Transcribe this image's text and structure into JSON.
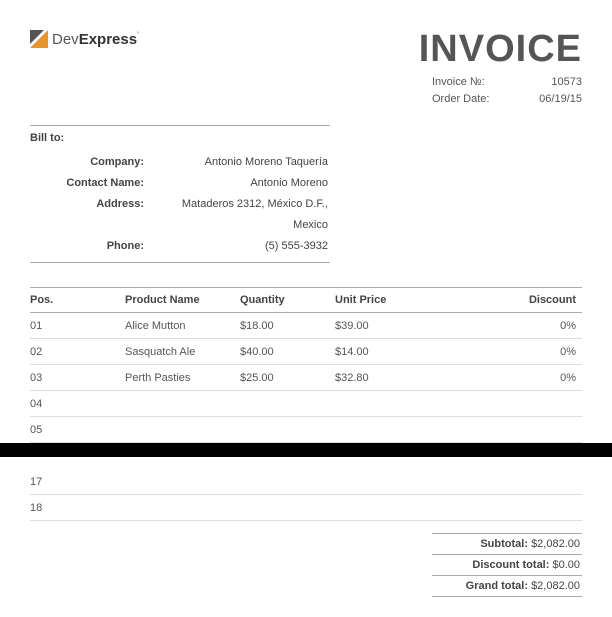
{
  "logo": {
    "dev": "Dev",
    "express": "Express",
    "tm": "'"
  },
  "title": "INVOICE",
  "meta": {
    "invoiceNumLabel": "Invoice №:",
    "invoiceNum": "10573",
    "orderDateLabel": "Order Date:",
    "orderDate": "06/19/15"
  },
  "billto": {
    "title": "Bill to:",
    "rows": [
      {
        "label": "Company:",
        "value": "Antonio Moreno Taquería"
      },
      {
        "label": "Contact Name:",
        "value": "Antonio Moreno"
      },
      {
        "label": "Address:",
        "value": "Mataderos  2312, México D.F., Mexico"
      },
      {
        "label": "Phone:",
        "value": "(5) 555-3932"
      }
    ]
  },
  "columns": {
    "pos": "Pos.",
    "prod": "Product Name",
    "qty": "Quantity",
    "unit": "Unit Price",
    "disc": "Discount"
  },
  "items": [
    {
      "pos": "01",
      "prod": "Alice Mutton",
      "qty": "$18.00",
      "unit": "$39.00",
      "disc": "0%"
    },
    {
      "pos": "02",
      "prod": "Sasquatch Ale",
      "qty": "$40.00",
      "unit": "$14.00",
      "disc": "0%"
    },
    {
      "pos": "03",
      "prod": "Perth Pasties",
      "qty": "$25.00",
      "unit": "$32.80",
      "disc": "0%"
    },
    {
      "pos": "04",
      "prod": "",
      "qty": "",
      "unit": "",
      "disc": ""
    },
    {
      "pos": "05",
      "prod": "",
      "qty": "",
      "unit": "",
      "disc": ""
    }
  ],
  "itemsLower": [
    {
      "pos": "17",
      "prod": "",
      "qty": "",
      "unit": "",
      "disc": ""
    },
    {
      "pos": "18",
      "prod": "",
      "qty": "",
      "unit": "",
      "disc": ""
    }
  ],
  "totals": {
    "subtotalLabel": "Subtotal:",
    "subtotal": "$2,082.00",
    "discountLabel": "Discount total:",
    "discount": "$0.00",
    "grandLabel": "Grand total:",
    "grand": "$2,082.00"
  }
}
